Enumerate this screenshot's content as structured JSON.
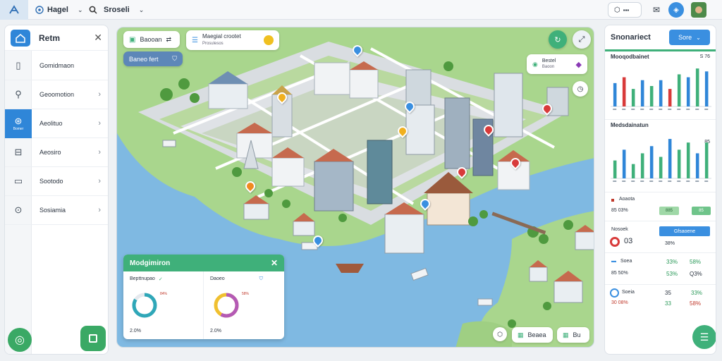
{
  "topbar": {
    "item1_label": "Hagel",
    "item2_label": "Sroseli"
  },
  "left_panel": {
    "title": "Retm",
    "items": [
      {
        "label": "Gomidmaon",
        "icon": "map-icon"
      },
      {
        "label": "Geoomotion",
        "icon": "person-icon"
      },
      {
        "label": "Aeolituo",
        "icon": "compass-icon",
        "active": true,
        "sub": "Bomer"
      },
      {
        "label": "Aeosiro",
        "icon": "layers-icon"
      },
      {
        "label": "Sootodo",
        "icon": "bookmark-icon"
      },
      {
        "label": "Sosiamia",
        "icon": "settings-icon"
      }
    ]
  },
  "map": {
    "chip1_label": "Baooan",
    "chip2_title": "Maegial crootet",
    "chip2_sub": "Prosulesos",
    "chip3_label": "Baneo fert",
    "chip4_title": "Bestel",
    "chip4_sub": "Baoon",
    "bottom_btn1": "Beaea",
    "bottom_btn2": "Bu"
  },
  "nav_popup": {
    "title": "Modgimiron",
    "col1_title": "Bepttnupao",
    "col1_pct": "84%",
    "col1_value": "2.0%",
    "col2_title": "Daoeo",
    "col2_pct": "58%",
    "col2_value": "2.0%"
  },
  "right_panel": {
    "title": "Snonariect",
    "button": "Sore",
    "chart1": {
      "title": "Mooqodbainet",
      "pct": "S 76",
      "values": [
        8,
        10,
        6,
        9,
        7,
        9,
        6,
        11,
        10,
        13,
        12
      ]
    },
    "chart2": {
      "title": "Medsdainatun",
      "pct": "85",
      "values": [
        5,
        8,
        4,
        7,
        9,
        6,
        11,
        8,
        10,
        7,
        10
      ]
    },
    "row1": {
      "label": "Aoaota",
      "sub": "85 03%",
      "chip1": "885",
      "chip2": "85"
    },
    "row2": {
      "label": "Nosoek",
      "value": "03",
      "button": "Gfsaoene",
      "pct": "38%"
    },
    "row3": {
      "label": "Soea",
      "sub1": "85 50%",
      "a": "33%",
      "b": "58%",
      "c": "53%",
      "d": "Q3%"
    },
    "row4": {
      "label": "Soeia",
      "sub1": "30 08%",
      "a": "35",
      "b": "33%",
      "c": "33",
      "d": "58%"
    }
  },
  "colors": {
    "accent_blue": "#2f86d8",
    "accent_green": "#3fb07a",
    "water": "#7bb6e0",
    "land": "#a9d68d"
  }
}
